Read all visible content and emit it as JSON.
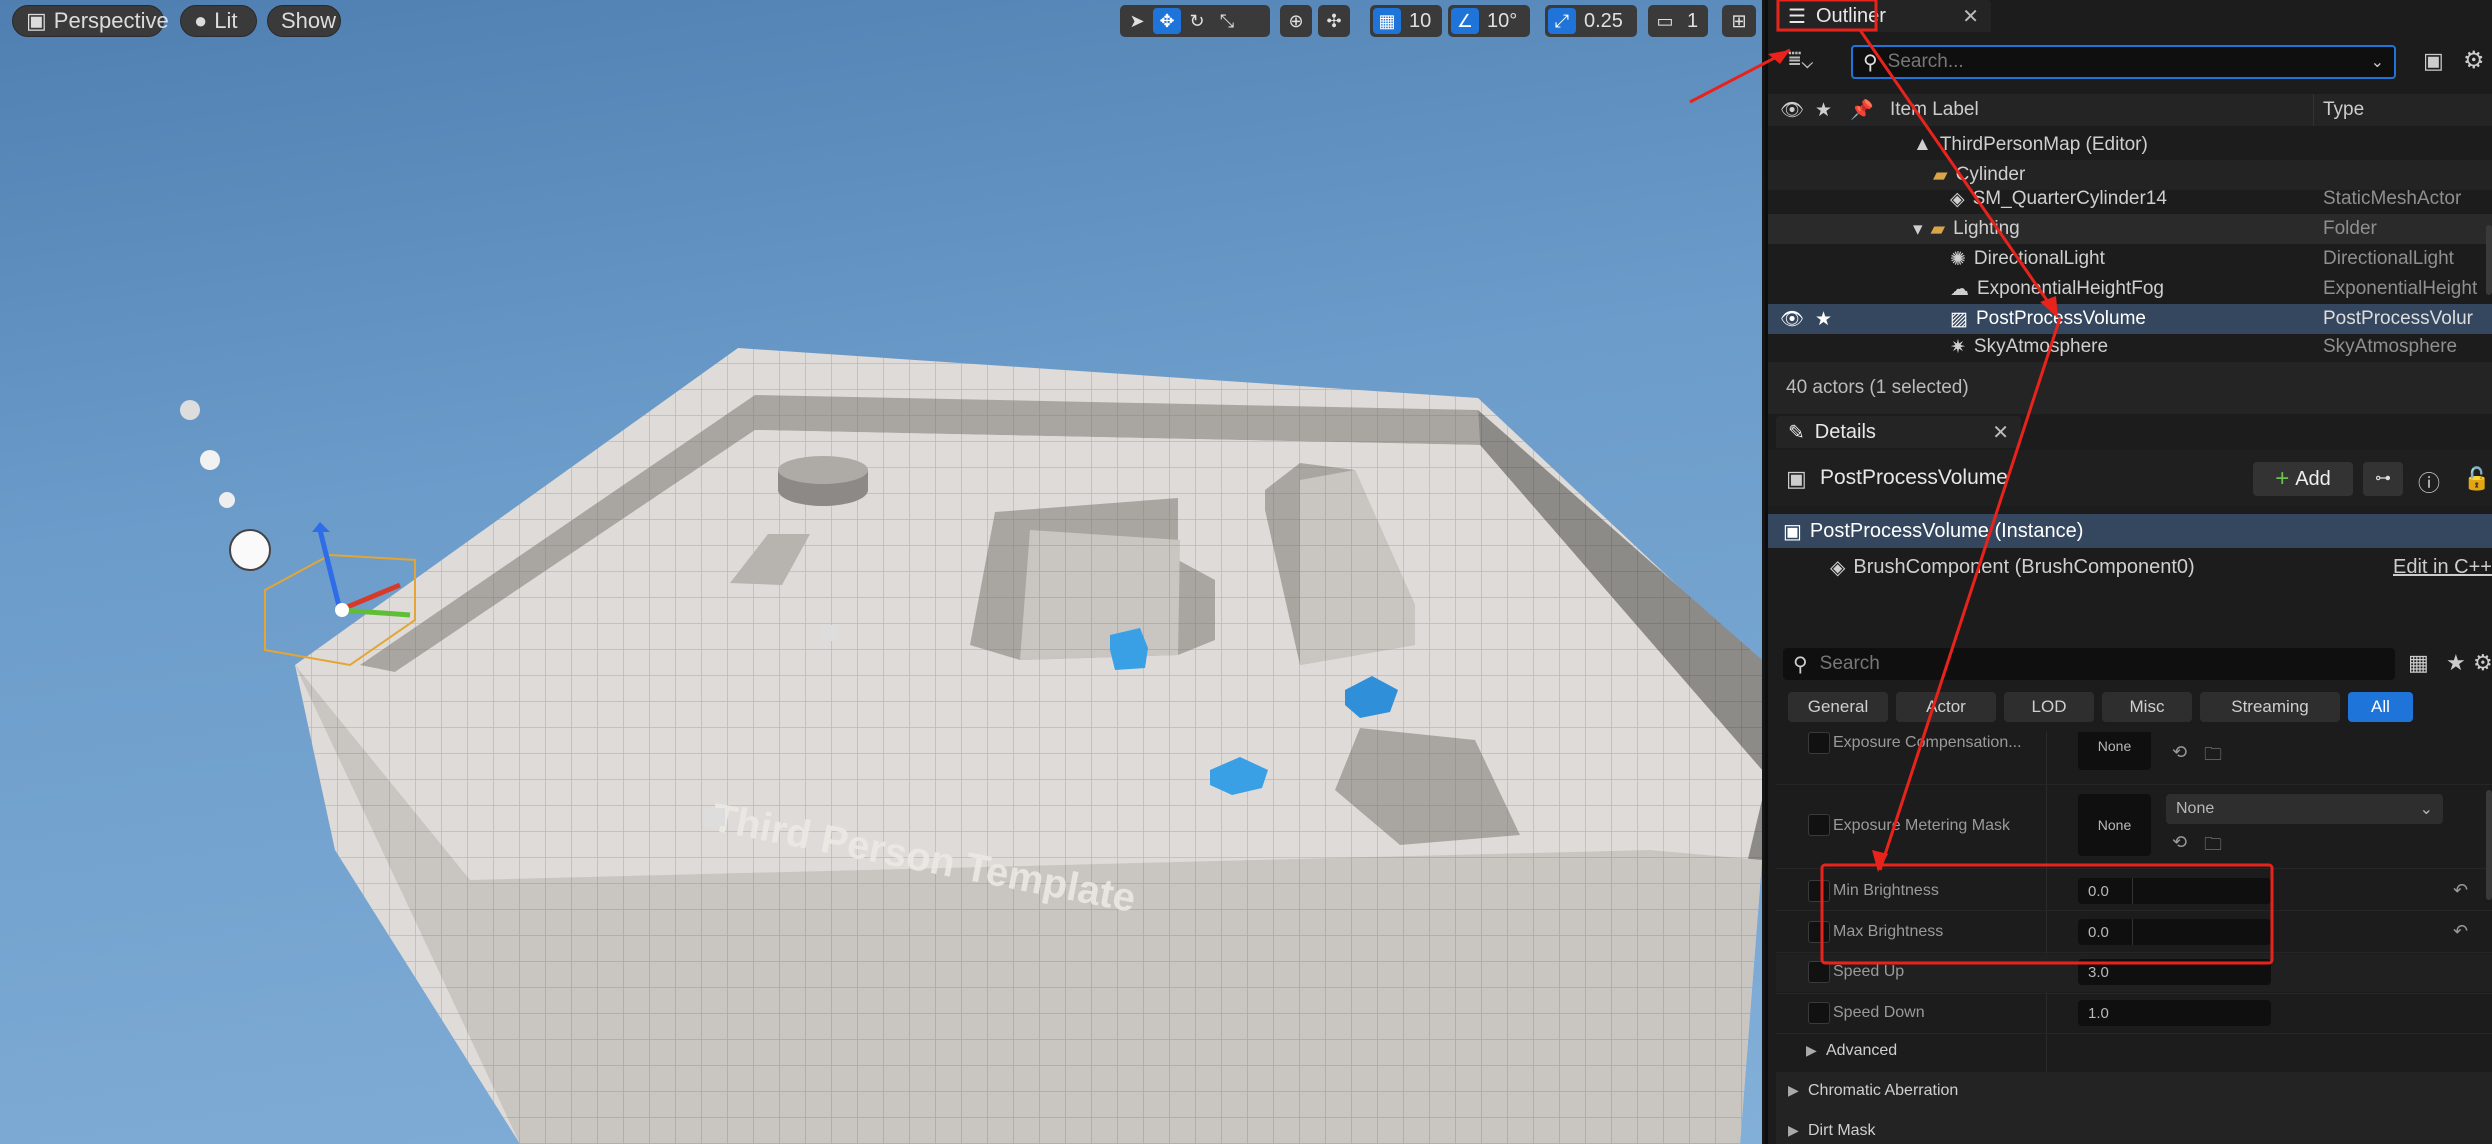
{
  "viewport": {
    "perspective_label": "Perspective",
    "lit_label": "Lit",
    "show_label": "Show",
    "grid_snap": "10",
    "rotate_snap": "10°",
    "scale_snap": "0.25",
    "camera_speed": "1",
    "floor_text": "Third Person Template"
  },
  "outliner": {
    "tab_title": "Outliner",
    "search_placeholder": "Search...",
    "col_label": "Item Label",
    "col_type": "Type",
    "rows": [
      {
        "label": "ThirdPersonMap (Editor)",
        "type": ""
      },
      {
        "label": "Cylinder",
        "type": ""
      },
      {
        "label": "SM_QuarterCylinder14",
        "type": "StaticMeshActor"
      },
      {
        "label": "Lighting",
        "type": "Folder"
      },
      {
        "label": "DirectionalLight",
        "type": "DirectionalLight"
      },
      {
        "label": "ExponentialHeightFog",
        "type": "ExponentialHeight"
      },
      {
        "label": "PostProcessVolume",
        "type": "PostProcessVolur"
      },
      {
        "label": "SkyAtmosphere",
        "type": "SkyAtmosphere"
      }
    ],
    "status": "40 actors (1 selected)"
  },
  "details": {
    "tab_title": "Details",
    "actor_name": "PostProcessVolume",
    "add_label": "Add",
    "instance_label": "PostProcessVolume (Instance)",
    "component_label": "BrushComponent (BrushComponent0)",
    "edit_cpp": "Edit in C++",
    "search_placeholder": "Search",
    "filter_tabs": [
      "General",
      "Actor",
      "LOD",
      "Misc",
      "Streaming",
      "All"
    ],
    "props": {
      "exposure_comp": "Exposure Compensation...",
      "exposure_comp_value": "None",
      "metering_mask": "Exposure Metering Mask",
      "metering_mask_value": "None",
      "metering_mask_select": "None",
      "min_brightness": "Min Brightness",
      "min_brightness_value": "0.0",
      "max_brightness": "Max Brightness",
      "max_brightness_value": "0.0",
      "speed_up": "Speed Up",
      "speed_up_value": "3.0",
      "speed_down": "Speed Down",
      "speed_down_value": "1.0",
      "advanced": "Advanced",
      "chromatic": "Chromatic Aberration",
      "dirt_mask": "Dirt Mask"
    }
  },
  "colors": {
    "accent": "#1e74d8",
    "annotation": "#e8231c",
    "selected_row": "#35475e"
  }
}
